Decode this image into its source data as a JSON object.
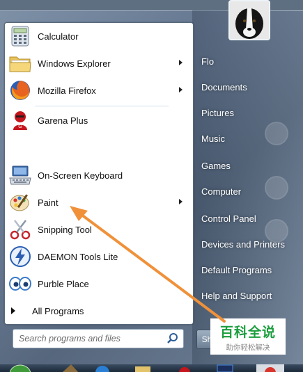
{
  "start_menu": {
    "pinned_programs": [
      {
        "label": "Calculator",
        "has_submenu": false
      },
      {
        "label": "Windows Explorer",
        "has_submenu": true
      },
      {
        "label": "Mozilla Firefox",
        "has_submenu": true
      }
    ],
    "recent_programs": [
      {
        "label": "Garena Plus",
        "has_submenu": false
      },
      {
        "label": "On-Screen Keyboard",
        "has_submenu": false
      },
      {
        "label": "Paint",
        "has_submenu": true
      },
      {
        "label": "Snipping Tool",
        "has_submenu": false
      },
      {
        "label": "DAEMON Tools Lite",
        "has_submenu": false
      },
      {
        "label": "Purble Place",
        "has_submenu": false
      }
    ],
    "all_programs_label": "All Programs",
    "search_placeholder": "Search programs and files",
    "right_links": [
      "Flo",
      "Documents",
      "Pictures",
      "Music",
      "Games",
      "Computer",
      "Control Panel",
      "Devices and Printers",
      "Default Programs",
      "Help and Support"
    ],
    "shutdown_label": "Sh"
  },
  "watermark": {
    "title": "百科全说",
    "subtitle": "助你轻松解决"
  },
  "colors": {
    "accent_arrow": "#f0913a",
    "watermark_green": "#1a9d3c"
  },
  "icons": {
    "calculator": "calculator-icon",
    "explorer": "folder-icon",
    "firefox": "firefox-icon",
    "garena": "garena-icon",
    "keyboard": "keyboard-icon",
    "paint": "paint-palette-icon",
    "snipping": "scissors-icon",
    "daemon": "lightning-icon",
    "purble": "eyes-icon",
    "search": "magnifier-icon"
  }
}
